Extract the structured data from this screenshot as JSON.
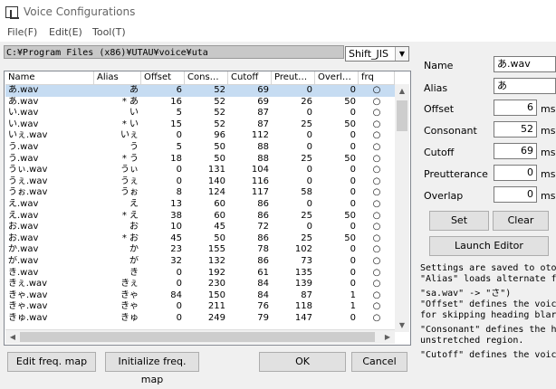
{
  "window": {
    "title": "Voice Configurations"
  },
  "menu": {
    "file": "File(F)",
    "edit": "Edit(E)",
    "tool": "Tool(T)"
  },
  "path": "C:¥Program Files (x86)¥UTAU¥voice¥uta",
  "encoding": "Shift_JIS",
  "table": {
    "columns": [
      "Name",
      "Alias",
      "Offset",
      "Cons…",
      "Cutoff",
      "Preut…",
      "Overl…",
      "frq"
    ],
    "rows": [
      [
        "あ.wav",
        "あ",
        "6",
        "52",
        "69",
        "0",
        "0",
        "○"
      ],
      [
        "あ.wav",
        "* あ",
        "16",
        "52",
        "69",
        "26",
        "50",
        "○"
      ],
      [
        "い.wav",
        "い",
        "5",
        "52",
        "87",
        "0",
        "0",
        "○"
      ],
      [
        "い.wav",
        "* い",
        "15",
        "52",
        "87",
        "25",
        "50",
        "○"
      ],
      [
        "いぇ.wav",
        "いぇ",
        "0",
        "96",
        "112",
        "0",
        "0",
        "○"
      ],
      [
        "う.wav",
        "う",
        "5",
        "50",
        "88",
        "0",
        "0",
        "○"
      ],
      [
        "う.wav",
        "* う",
        "18",
        "50",
        "88",
        "25",
        "50",
        "○"
      ],
      [
        "うぃ.wav",
        "うぃ",
        "0",
        "131",
        "104",
        "0",
        "0",
        "○"
      ],
      [
        "うぇ.wav",
        "うぇ",
        "0",
        "140",
        "116",
        "0",
        "0",
        "○"
      ],
      [
        "うぉ.wav",
        "うぉ",
        "8",
        "124",
        "117",
        "58",
        "0",
        "○"
      ],
      [
        "え.wav",
        "え",
        "13",
        "60",
        "86",
        "0",
        "0",
        "○"
      ],
      [
        "え.wav",
        "* え",
        "38",
        "60",
        "86",
        "25",
        "50",
        "○"
      ],
      [
        "お.wav",
        "お",
        "10",
        "45",
        "72",
        "0",
        "0",
        "○"
      ],
      [
        "お.wav",
        "* お",
        "45",
        "50",
        "86",
        "25",
        "50",
        "○"
      ],
      [
        "か.wav",
        "か",
        "23",
        "155",
        "78",
        "102",
        "0",
        "○"
      ],
      [
        "が.wav",
        "が",
        "32",
        "132",
        "86",
        "73",
        "0",
        "○"
      ],
      [
        "き.wav",
        "き",
        "0",
        "192",
        "61",
        "135",
        "0",
        "○"
      ],
      [
        "きぇ.wav",
        "きぇ",
        "0",
        "230",
        "84",
        "139",
        "0",
        "○"
      ],
      [
        "きゃ.wav",
        "きゃ",
        "84",
        "150",
        "84",
        "87",
        "1",
        "○"
      ],
      [
        "きゃ.wav",
        "きゃ",
        "0",
        "211",
        "76",
        "118",
        "1",
        "○"
      ],
      [
        "きゅ.wav",
        "きゅ",
        "0",
        "249",
        "79",
        "147",
        "0",
        "○"
      ]
    ]
  },
  "form": {
    "name_label": "Name",
    "name_value": "あ.wav",
    "alias_label": "Alias",
    "alias_value": "あ",
    "offset_label": "Offset",
    "offset_value": "6",
    "consonant_label": "Consonant",
    "consonant_value": "52",
    "cutoff_label": "Cutoff",
    "cutoff_value": "69",
    "preutterance_label": "Preutterance",
    "preutterance_value": "0",
    "overlap_label": "Overlap",
    "overlap_value": "0",
    "unit": "mse"
  },
  "buttons": {
    "set": "Set",
    "clear": "Clear",
    "launch_editor": "Launch Editor",
    "edit_freq_map": "Edit freq. map",
    "init_freq_map": "Initialize freq. map",
    "ok": "OK",
    "cancel": "Cancel"
  },
  "info_lines": [
    "Settings are saved to oto",
    "\"Alias\" loads alternate fi",
    "\"sa.wav\" -> \"さ\")",
    "\"Offset\" defines the voic",
    "for skipping heading blar",
    "\"Consonant\" defines the h",
    "unstretched region.",
    "\"Cutoff\" defines the voic"
  ]
}
